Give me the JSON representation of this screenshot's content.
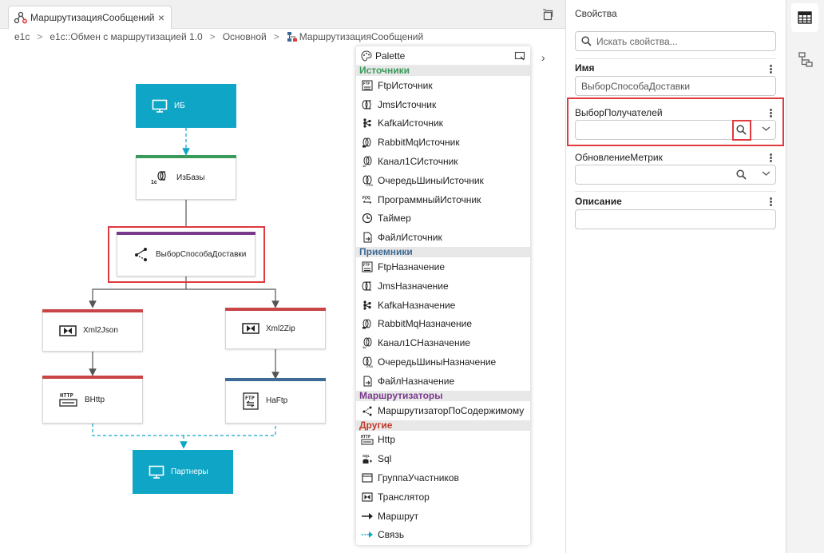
{
  "tab": {
    "title": "МаршрутизацияСообщений",
    "close": "×"
  },
  "breadcrumb": [
    "e1c",
    "e1c::Обмен с маршрутизацией 1.0",
    "Основной",
    "МаршрутизацияСообщений"
  ],
  "breadcrumb_sep": ">",
  "diagram": {
    "nodes": {
      "ib": "ИБ",
      "izbazy": "ИзБазы",
      "vybor": "ВыборСпособаДоставки",
      "xml2json": "Xml2Json",
      "xml2zip": "Xml2Zip",
      "vhttp": "ВHttp",
      "naftp": "НаFtp",
      "partnery": "Партнеры"
    },
    "izbazy_badge": "1c"
  },
  "palette": {
    "title": "Palette",
    "categories": [
      {
        "name": "Источники",
        "color": "#3a9a5b",
        "items": [
          {
            "label": "FtpИсточник",
            "icon": "ftp-icon"
          },
          {
            "label": "JmsИсточник",
            "icon": "jms-icon"
          },
          {
            "label": "KafkaИсточник",
            "icon": "kafka-icon"
          },
          {
            "label": "RabbitMqИсточник",
            "icon": "rabbitmq-icon"
          },
          {
            "label": "Канал1СИсточник",
            "icon": "channel-1c-icon"
          },
          {
            "label": "ОчередьШиныИсточник",
            "icon": "bus-queue-icon"
          },
          {
            "label": "ПрограммныйИсточник",
            "icon": "program-icon"
          },
          {
            "label": "Таймер",
            "icon": "timer-icon"
          },
          {
            "label": "ФайлИсточник",
            "icon": "file-icon"
          }
        ]
      },
      {
        "name": "Приемники",
        "color": "#3d6b94",
        "items": [
          {
            "label": "FtpНазначение",
            "icon": "ftp-icon"
          },
          {
            "label": "JmsНазначение",
            "icon": "jms-icon"
          },
          {
            "label": "KafkaНазначение",
            "icon": "kafka-icon"
          },
          {
            "label": "RabbitMqНазначение",
            "icon": "rabbitmq-icon"
          },
          {
            "label": "Канал1СНазначение",
            "icon": "channel-1c-icon"
          },
          {
            "label": "ОчередьШиныНазначение",
            "icon": "bus-queue-icon"
          },
          {
            "label": "ФайлНазначение",
            "icon": "file-icon"
          }
        ]
      },
      {
        "name": "Маршрутизаторы",
        "color": "#7a3a8c",
        "items": [
          {
            "label": "МаршрутизаторПоСодержимому",
            "icon": "router-icon"
          }
        ]
      },
      {
        "name": "Другие",
        "color": "#c0392b",
        "items": [
          {
            "label": "Http",
            "icon": "http-icon"
          },
          {
            "label": "Sql",
            "icon": "sql-icon"
          },
          {
            "label": "ГруппаУчастников",
            "icon": "group-icon"
          },
          {
            "label": "Транслятор",
            "icon": "translator-icon"
          },
          {
            "label": "Маршрут",
            "icon": "route-arrow-icon"
          },
          {
            "label": "Связь",
            "icon": "link-arrow-icon"
          }
        ]
      }
    ]
  },
  "properties": {
    "title": "Свойства",
    "search_placeholder": "Искать свойства...",
    "fields": {
      "name_label": "Имя",
      "name_value": "ВыборСпособаДоставки",
      "recipients_label": "ВыборПолучателей",
      "recipients_value": "",
      "metrics_label": "ОбновлениеМетрик",
      "metrics_value": "",
      "description_label": "Описание",
      "description_value": ""
    }
  },
  "colors": {
    "accent_blue": "#0ea5c6",
    "source_green": "#3a9a5b",
    "router_purple": "#7a3a8c",
    "transform_red": "#c94446",
    "dest_blue": "#3d6b94",
    "highlight_red": "#e0393e"
  }
}
